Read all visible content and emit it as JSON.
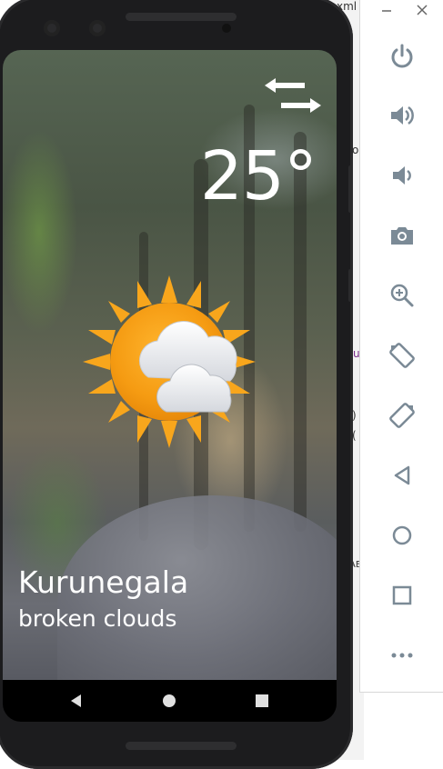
{
  "weather": {
    "temperature": "25°",
    "city": "Kurunegala",
    "description": "broken clouds"
  },
  "background_window": {
    "fragments": [
      "xml",
      "o",
      "u",
      "(",
      ")",
      "AE"
    ]
  },
  "icons": {
    "swap": "swap-arrows-icon",
    "weather": "sun-with-clouds-icon",
    "nav": [
      "back-icon",
      "home-icon",
      "recents-icon"
    ],
    "toolbar": [
      "minimize-icon",
      "close-icon",
      "power-icon",
      "volume-up-icon",
      "volume-down-icon",
      "camera-icon",
      "zoom-icon",
      "rotate-left-icon",
      "rotate-right-icon",
      "back-icon",
      "home-icon",
      "overview-icon",
      "more-icon"
    ]
  },
  "colors": {
    "toolbar_icon": "#7b8a96",
    "sun": "#f7a21b",
    "text": "#ffffff"
  }
}
